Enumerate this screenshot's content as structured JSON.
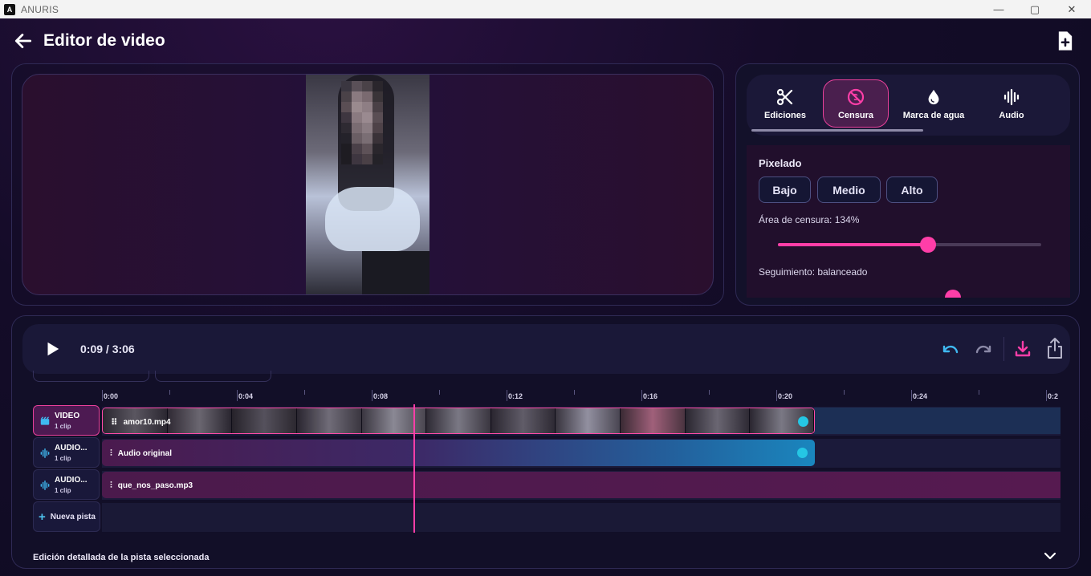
{
  "window": {
    "app_title": "ANURIS",
    "logo_letter": "A",
    "minimize": "—",
    "maximize": "▢",
    "close": "✕"
  },
  "header": {
    "title": "Editor de video",
    "back_icon": "arrow-left-icon",
    "new_icon": "file-plus-icon"
  },
  "tools": {
    "tabs": [
      {
        "label": "Ediciones",
        "icon": "scissors-icon"
      },
      {
        "label": "Censura",
        "icon": "censor-icon",
        "active": true
      },
      {
        "label": "Marca de agua",
        "icon": "drop-icon"
      },
      {
        "label": "Audio",
        "icon": "waveform-icon"
      }
    ],
    "pixel_section": "Pixelado",
    "pixel_options": [
      "Bajo",
      "Medio",
      "Alto"
    ],
    "area_label": "Área de censura: 134%",
    "area_value_fraction": 0.57,
    "tracking_label": "Seguimiento: balanceado"
  },
  "transport": {
    "time": "0:09 / 3:06",
    "icons": [
      "play-icon",
      "undo-icon",
      "redo-icon",
      "download-icon",
      "share-icon"
    ]
  },
  "timeline": {
    "ticks": [
      "0:00",
      "0:04",
      "0:08",
      "0:12",
      "0:16",
      "0:20",
      "0:24",
      "0:2"
    ],
    "tracks": [
      {
        "name": "VIDEO",
        "count": "1 clip",
        "clip": "amor10.mp4",
        "icon": "film-icon"
      },
      {
        "name": "AUDIO...",
        "count": "1 clip",
        "clip": "Audio original",
        "icon": "waveform-icon"
      },
      {
        "name": "AUDIO...",
        "count": "1 clip",
        "clip": "que_nos_paso.mp3",
        "icon": "waveform-icon"
      }
    ],
    "new_track": "Nueva pista",
    "detail_label": "Edición detallada de la pista seleccionada"
  },
  "colors": {
    "accent": "#ff3ea8",
    "cyan": "#25c6e4",
    "panel": "#13112a"
  }
}
